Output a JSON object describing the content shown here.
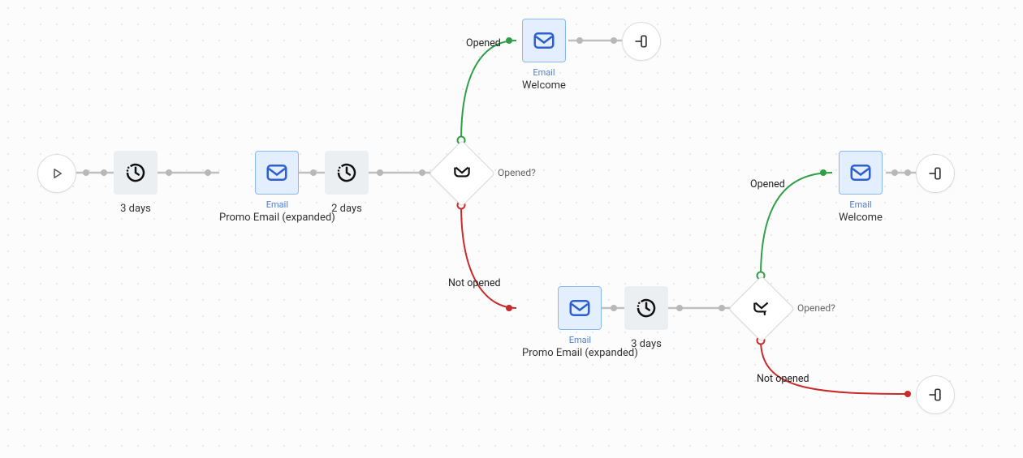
{
  "colors": {
    "wire_gray": "#bfbfbf",
    "wire_green": "#2f9e44",
    "wire_red": "#c92a2a",
    "email_bg": "#e3efff",
    "email_border": "#8ab8f5",
    "wait_bg": "#eceff1"
  },
  "start": {
    "label": "Start"
  },
  "wait1": {
    "label": "3 days"
  },
  "email1": {
    "type_label": "Email",
    "name": "Promo Email (expanded)"
  },
  "wait2": {
    "label": "2 days"
  },
  "decision1": {
    "question": "Opened?",
    "branch_yes": "Opened",
    "branch_no": "Not opened"
  },
  "email_top": {
    "type_label": "Email",
    "name": "Welcome"
  },
  "end_top": {
    "label": "End"
  },
  "email_bottom": {
    "type_label": "Email",
    "name": "Promo Email (expanded)"
  },
  "wait3": {
    "label": "3 days"
  },
  "decision2": {
    "question": "Opened?",
    "branch_yes": "Opened",
    "branch_no": "Not opened"
  },
  "email_right": {
    "type_label": "Email",
    "name": "Welcome"
  },
  "end_right": {
    "label": "End"
  },
  "end_bottom_right": {
    "label": "End"
  }
}
